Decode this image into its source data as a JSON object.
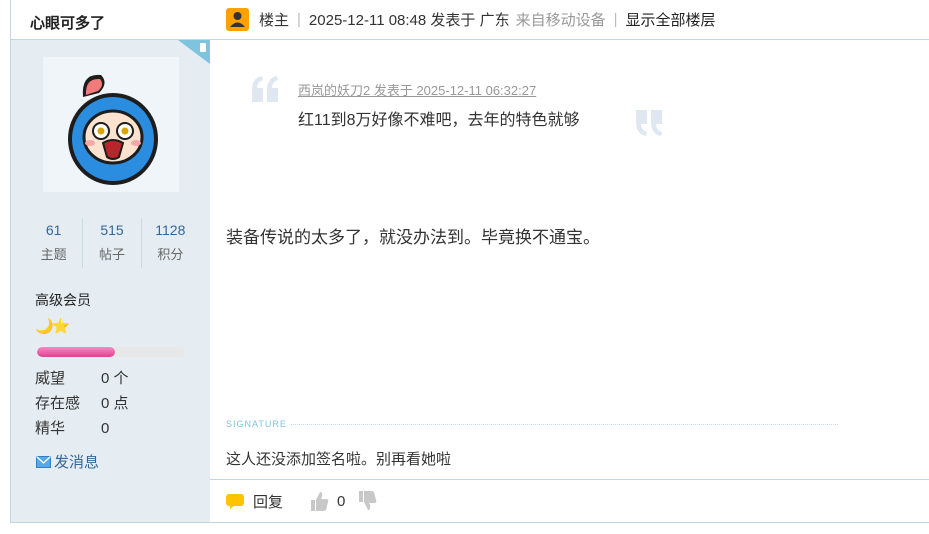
{
  "user": {
    "name": "心眼可多了",
    "stats": [
      {
        "value": "61",
        "label": "主题"
      },
      {
        "value": "515",
        "label": "帖子"
      },
      {
        "value": "1128",
        "label": "积分"
      }
    ],
    "group": "高级会员",
    "rank_icons": "🌙⭐",
    "progress_fraction": 0.53,
    "info": [
      {
        "label": "威望",
        "value": "0 个"
      },
      {
        "label": "存在感",
        "value": "0 点"
      },
      {
        "label": "精华",
        "value": "0"
      }
    ],
    "pm_label": "发消息"
  },
  "header": {
    "host_label": "楼主",
    "sep": "|",
    "posted": "2025-12-11 08:48 发表于 广东",
    "device": "来自移动设备",
    "show_all": "显示全部楼层"
  },
  "quote": {
    "meta": "西岚的妖刀2 发表于 2025-12-11 06:32:27",
    "text": "红11到8万好像不难吧，去年的特色就够"
  },
  "body": "装备传说的太多了，就没办法到。毕竟换不通宝。",
  "signature": {
    "label": "SIGNATURE",
    "text": "这人还没添加签名啦。别再看她啦"
  },
  "footer": {
    "reply": "回复",
    "likes": "0"
  },
  "colors": {
    "accent": "#336699",
    "sidebar_bg": "#e5edf2",
    "border": "#c2d5e3",
    "host_icon": "#ffa100"
  }
}
